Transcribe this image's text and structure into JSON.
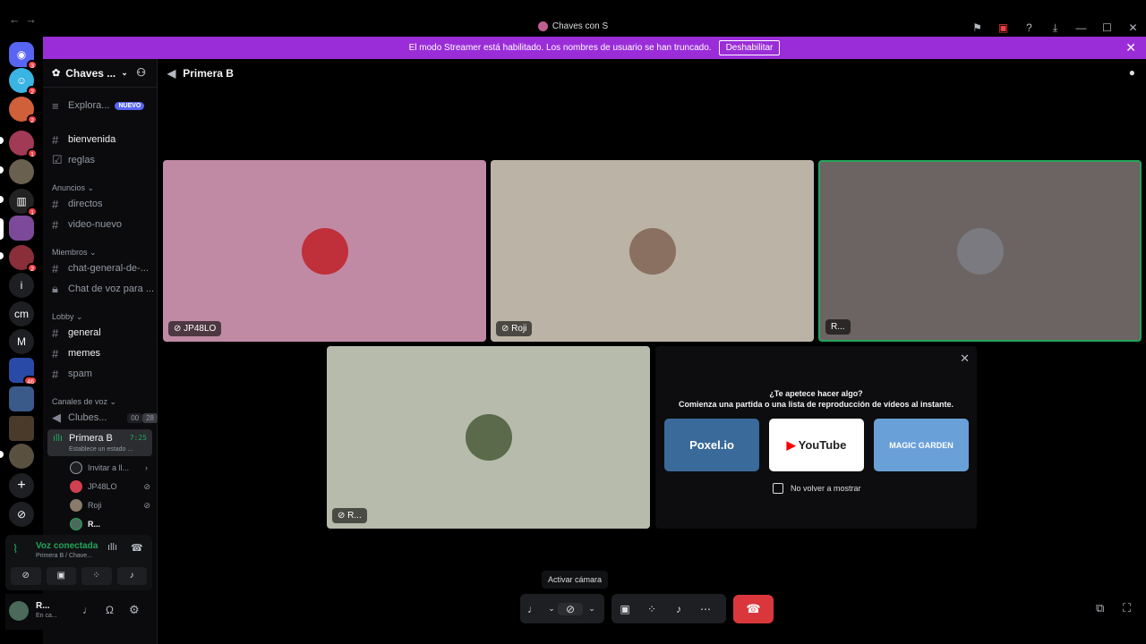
{
  "titlebar": {
    "back_label": "←",
    "forward_label": "→",
    "title": "Chaves con S"
  },
  "banner": {
    "message": "El modo Streamer está habilitado. Los nombres de usuario se han truncado.",
    "button_label": "Deshabilitar",
    "close_label": "✕"
  },
  "servers": {
    "badges": [
      "3",
      "2",
      "2",
      "1",
      "1",
      "2",
      "46"
    ],
    "letters": [
      "i",
      "cm",
      "M"
    ],
    "add_label": "+"
  },
  "sidebar": {
    "server_name": "Chaves ...",
    "explore_label": "Explora...",
    "new_badge": "NUEVO",
    "channels_top": [
      "bienvenida",
      "reglas"
    ],
    "cat_anuncios": "Anuncios",
    "channels_anuncios": [
      "directos",
      "video-nuevo"
    ],
    "cat_miembros": "Miembros",
    "channels_miembros": [
      "chat-general-de-...",
      "Chat de voz para ..."
    ],
    "cat_lobby": "Lobby",
    "channels_lobby": [
      "general",
      "memes",
      "spam"
    ],
    "cat_voz": "Canales de voz",
    "voice_channel_1": "Clubes...",
    "voice_channel_1_counts": [
      "00",
      "28"
    ],
    "active_voice": "Primera B",
    "active_voice_time": "7:25",
    "active_voice_status": "Establece un estado ...",
    "invite_label": "Invitar a ll...",
    "members": [
      "JP48LO",
      "Roji",
      "R..."
    ]
  },
  "voice_panel": {
    "status": "Voz conectada",
    "channel": "Primera B / Chave..."
  },
  "user_panel": {
    "name": "R...",
    "status": "En ca..."
  },
  "main": {
    "channel_title": "Primera B",
    "tiles": [
      "JP48LO",
      "Roji",
      "R...",
      "R..."
    ],
    "activity_title": "¿Te apetece hacer algo?",
    "activity_subtitle": "Comienza una partida o una lista de reproducción de vídeos al instante.",
    "activity_cards": [
      "Poxel.io",
      "YouTube",
      "MAGIC GARDEN"
    ],
    "dont_show_label": "No volver a mostrar",
    "tooltip": "Activar cámara"
  },
  "colors": {
    "tile1": "#c08aa4",
    "tile2": "#bbb3a5",
    "tile3": "#6b6462",
    "tile4": "#b6bbab",
    "banner": "#9b2dd9",
    "speaking": "#23a55a",
    "hangup": "#da373c"
  }
}
